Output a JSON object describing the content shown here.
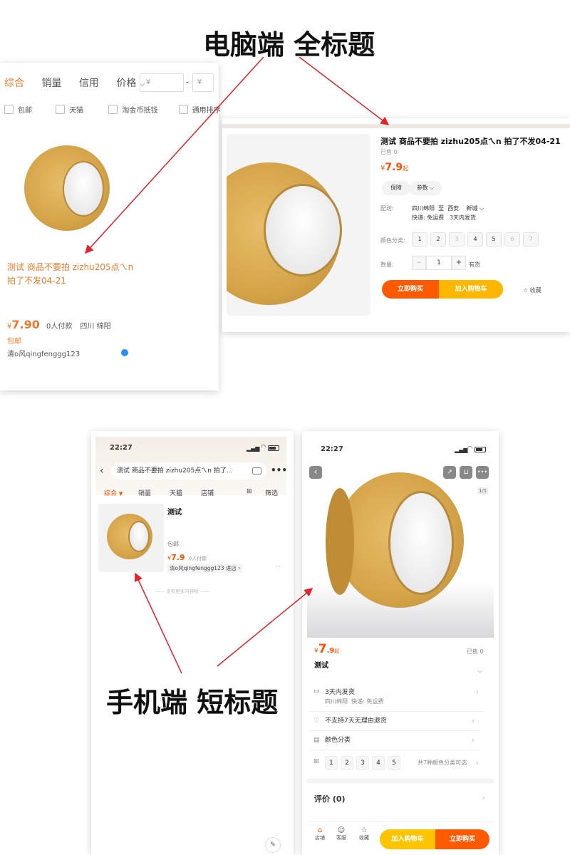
{
  "annotations": {
    "pc_title": "电脑端 全标题",
    "mobile_title": "手机端 短标题"
  },
  "pc_search": {
    "sort_tabs": [
      "综合",
      "销量",
      "信用",
      "价格"
    ],
    "price_placeholder": "¥",
    "price_dash": "-",
    "filters": [
      "包邮",
      "天猫",
      "淘金币抵钱",
      "通用排序"
    ],
    "item_title": "测试 商品不要拍 zizhu205点ㄟn 拍了不发04-21",
    "price_symbol": "¥",
    "price": "7.90",
    "payers": "0人付款",
    "location": "四川 绵阳",
    "free_ship": "包邮",
    "shop": "清o风qingfenggg123"
  },
  "pc_detail": {
    "title": "测试 商品不要拍 zizhu205点ㄟn 拍了不发04-21",
    "sold": "已售 0",
    "price_symbol": "¥",
    "price": "7.9",
    "price_suffix": "起",
    "tag_guarantee": "保障",
    "tag_params": "参数",
    "ship_label": "配送:",
    "ship_from": "四川绵阳",
    "ship_to_word": "至",
    "ship_to": "西安",
    "ship_district": "新城",
    "ship_info": "快递: 免运费   3天内发货",
    "color_label": "颜色分类:",
    "colors": [
      "1",
      "2",
      "3",
      "4",
      "5",
      "6",
      "7"
    ],
    "qty_label": "数量:",
    "qty_minus": "−",
    "qty_value": "1",
    "qty_plus": "+",
    "stock": "有货",
    "buy_now": "立即购买",
    "add_cart": "加入购物车",
    "favorite": "☆ 收藏"
  },
  "mobile_search": {
    "time": "22:27",
    "search_text": "测试  商品不要拍 zizhu205点ㄟn 拍了...",
    "tabs": [
      "综合",
      "销量",
      "天猫",
      "店铺",
      "筛选"
    ],
    "item_title": "测试",
    "free_ship": "包邮",
    "price_symbol": "¥",
    "price": "7.9",
    "payers": "0人付款",
    "shop": "清o风qingfenggg123 进店 ›",
    "more": "···",
    "no_more": "—— 没有更多内容啦 ——"
  },
  "mobile_detail": {
    "time": "22:27",
    "image_index": "1/1",
    "price_symbol": "¥",
    "price": "7",
    "price_decimal": ".9",
    "price_suffix": "起",
    "sold": "已售 0",
    "title": "测试",
    "ship_time": "3天内发货",
    "ship_info": "四川绵阳  快递: 免运费",
    "return_policy": "不支持7天无理由退货",
    "color_category": "颜色分类",
    "color_options": [
      "1",
      "2",
      "3",
      "4",
      "5"
    ],
    "color_summary": "共7种颜色分类可选",
    "reviews": "评价 (0)",
    "nav_shop": "店铺",
    "nav_service": "客服",
    "nav_fav": "收藏",
    "add_cart": "加入购物车",
    "buy_now": "立即购买"
  },
  "colors": {
    "accent": "#ff5000",
    "price_orange": "#ff5000",
    "search_price": "#f07a2a",
    "arrow": "#e8202a"
  }
}
